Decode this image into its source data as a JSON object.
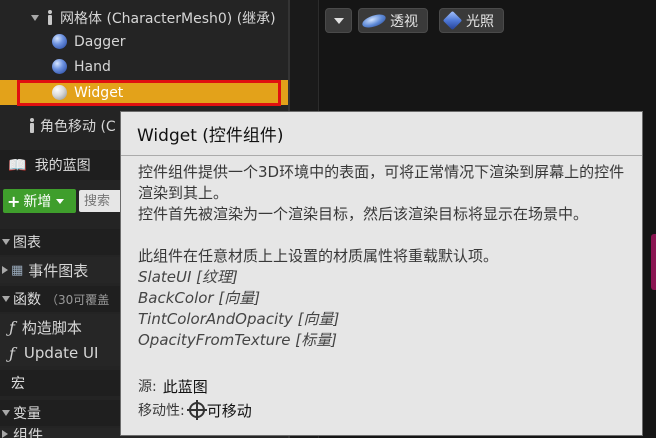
{
  "components": {
    "mesh_label": "网格体 (CharacterMesh0) (继承)",
    "items": [
      {
        "label": "Dagger"
      },
      {
        "label": "Hand"
      },
      {
        "label": "Widget"
      }
    ],
    "movement_label": "角色移动 (C"
  },
  "my_blueprint": {
    "title": "我的蓝图",
    "new_button": "新增",
    "search_placeholder": "搜索"
  },
  "sections": {
    "graphs": "图表",
    "event_graph": "事件图表",
    "functions": "函数",
    "functions_count": "（30可覆盖",
    "construction_script": "构造脚本",
    "update_ui": "Update UI",
    "macros": "宏",
    "variables": "变量",
    "partial": "组件"
  },
  "viewport": {
    "perspective": "透视",
    "lit": "光照"
  },
  "tooltip": {
    "title": "Widget (控件组件)",
    "desc1": "控件组件提供一个3D环境中的表面，可将正常情况下渲染到屏幕上的控件渲染到其上。",
    "desc2": "控件首先被渲染为一个渲染目标，然后该渲染目标将显示在场景中。",
    "desc3": "此组件在任意材质上上设置的材质属性将重载默认项。",
    "params": [
      "SlateUI [纹理]",
      "BackColor [向量]",
      "TintColorAndOpacity [向量]",
      "OpacityFromTexture [标量]"
    ],
    "source_label": "源:",
    "source_value": "此蓝图",
    "mobility_label": "移动性:",
    "mobility_value": "可移动"
  },
  "colors": {
    "selection": "#e3a21a",
    "highlight_border": "#e01010",
    "new_button": "#3f9e2c"
  }
}
